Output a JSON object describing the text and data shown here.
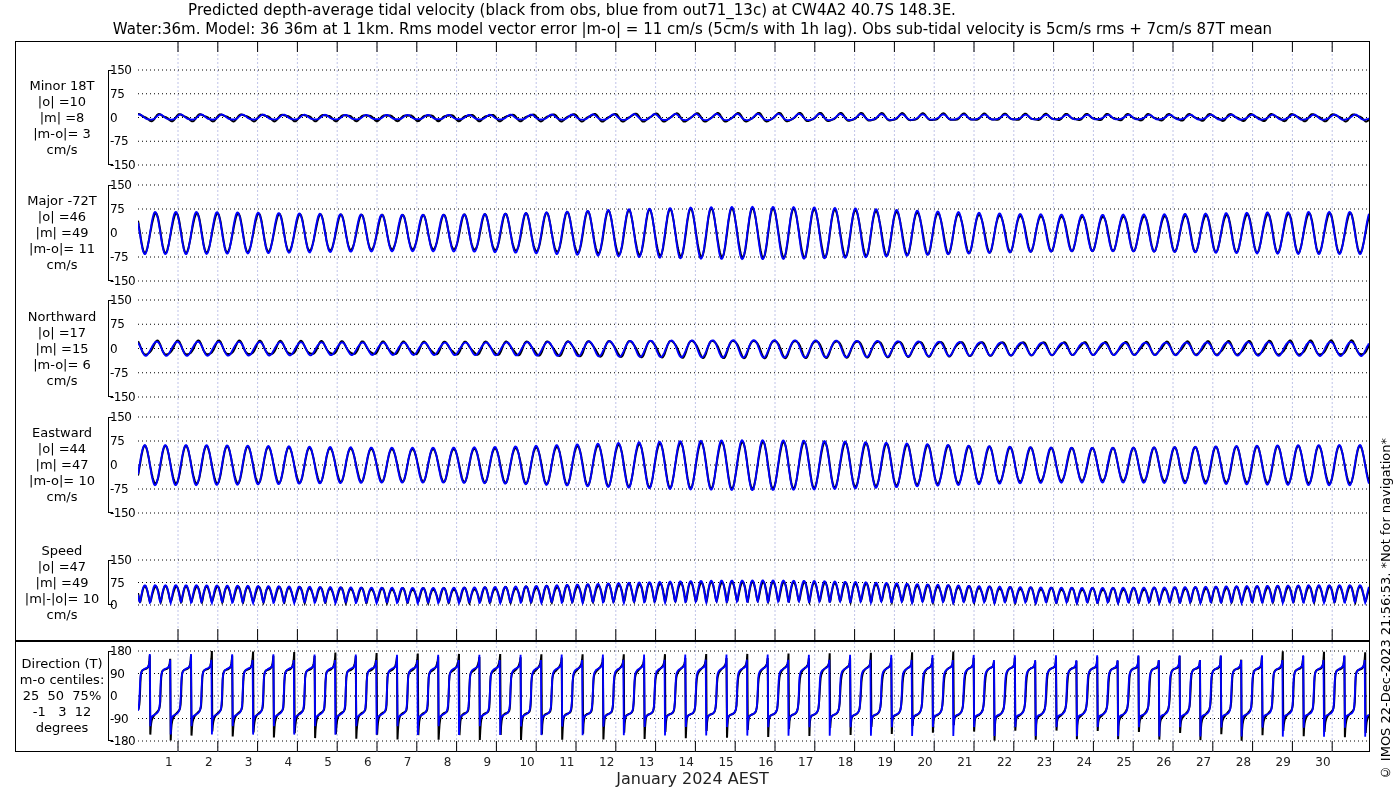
{
  "title": [
    "Predicted depth-average tidal velocity (black from obs, blue from out71_13c) at CW4A2 40.7S 148.3E.",
    "Water:36m. Model: 36 36m at 1 1km. Rms model vector error |m-o| = 11 cm/s (5cm/s with 1h lag). Obs sub-tidal velocity is 5cm/s rms + 7cm/s 87T mean"
  ],
  "panels": [
    {
      "kind": "minor",
      "label": [
        "Minor 18T",
        "|o| =10",
        "|m| =8",
        "|m-o|= 3",
        "cm/s"
      ],
      "yticks": [
        "150",
        "75",
        "0",
        "-75",
        "-150"
      ]
    },
    {
      "kind": "major",
      "label": [
        "Major -72T",
        "|o| =46",
        "|m| =49",
        "|m-o|= 11",
        "cm/s"
      ],
      "yticks": [
        "150",
        "75",
        "0",
        "-75",
        "-150"
      ]
    },
    {
      "kind": "northward",
      "label": [
        "Northward",
        "|o| =17",
        "|m| =15",
        "|m-o|= 6",
        "cm/s"
      ],
      "yticks": [
        "150",
        "75",
        "0",
        "-75",
        "-150"
      ]
    },
    {
      "kind": "eastward",
      "label": [
        "Eastward",
        "|o| =44",
        "|m| =47",
        "|m-o|= 10",
        "cm/s"
      ],
      "yticks": [
        "150",
        "75",
        "0",
        "-75",
        "-150"
      ]
    },
    {
      "kind": "speed",
      "label": [
        "Speed",
        "|o| =47",
        "|m| =49",
        "|m|-|o|= 10",
        "cm/s"
      ],
      "yticks": [
        "150",
        "75",
        "0"
      ]
    },
    {
      "kind": "direction",
      "label": [
        "Direction (T)",
        "m-o centiles:",
        "25  50  75%",
        "-1   3  12",
        "degrees"
      ],
      "yticks": [
        "180",
        "90",
        "0",
        "-90",
        "-180"
      ]
    }
  ],
  "x_axis": {
    "ticks": [
      "1",
      "2",
      "3",
      "4",
      "5",
      "6",
      "7",
      "8",
      "9",
      "10",
      "11",
      "12",
      "13",
      "14",
      "15",
      "16",
      "17",
      "18",
      "19",
      "20",
      "21",
      "22",
      "23",
      "24",
      "25",
      "26",
      "27",
      "28",
      "29",
      "30"
    ],
    "label": "January 2024 AEST"
  },
  "footnote": "© IMOS 22-Dec-2023 21:56:53. *Not for navigation*"
}
